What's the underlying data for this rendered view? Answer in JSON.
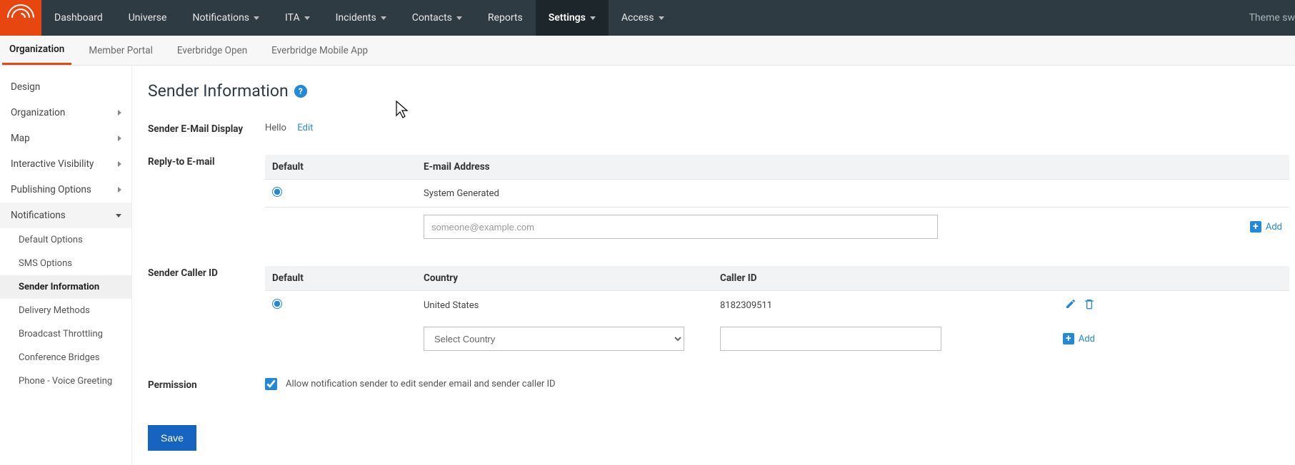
{
  "topnav": {
    "items": [
      {
        "label": "Dashboard",
        "hasDropdown": false
      },
      {
        "label": "Universe",
        "hasDropdown": false
      },
      {
        "label": "Notifications",
        "hasDropdown": true
      },
      {
        "label": "ITA",
        "hasDropdown": true
      },
      {
        "label": "Incidents",
        "hasDropdown": true
      },
      {
        "label": "Contacts",
        "hasDropdown": true
      },
      {
        "label": "Reports",
        "hasDropdown": false
      },
      {
        "label": "Settings",
        "hasDropdown": true,
        "active": true
      },
      {
        "label": "Access",
        "hasDropdown": true
      }
    ],
    "theme": "Theme sw"
  },
  "subtabs": [
    {
      "label": "Organization",
      "active": true
    },
    {
      "label": "Member Portal"
    },
    {
      "label": "Everbridge Open"
    },
    {
      "label": "Everbridge Mobile App"
    }
  ],
  "sidebar": {
    "Design": "Design",
    "Organization": "Organization",
    "Map": "Map",
    "InteractiveVisibility": "Interactive Visibility",
    "PublishingOptions": "Publishing Options",
    "Notifications": "Notifications",
    "sub": {
      "DefaultOptions": "Default Options",
      "SMSOptions": "SMS Options",
      "SenderInformation": "Sender Information",
      "DeliveryMethods": "Delivery Methods",
      "BroadcastThrottling": "Broadcast Throttling",
      "ConferenceBridges": "Conference Bridges",
      "PhoneVoiceGreeting": "Phone - Voice Greeting"
    }
  },
  "page": {
    "title": "Sender Information",
    "senderEmailDisplay": {
      "label": "Sender E-Mail Display",
      "value": "Hello",
      "editLabel": "Edit"
    },
    "replyTo": {
      "label": "Reply-to E-mail",
      "headers": {
        "default": "Default",
        "email": "E-mail Address"
      },
      "rows": [
        {
          "default": true,
          "email": "System Generated"
        }
      ],
      "placeholder": "someone@example.com",
      "addLabel": "Add"
    },
    "callerId": {
      "label": "Sender Caller ID",
      "headers": {
        "default": "Default",
        "country": "Country",
        "callerId": "Caller ID"
      },
      "rows": [
        {
          "default": true,
          "country": "United States",
          "callerId": "8182309511"
        }
      ],
      "selectPlaceholder": "Select Country",
      "addLabel": "Add"
    },
    "permission": {
      "label": "Permission",
      "text": "Allow notification sender to edit sender email and sender caller ID",
      "checked": true
    },
    "save": "Save"
  }
}
